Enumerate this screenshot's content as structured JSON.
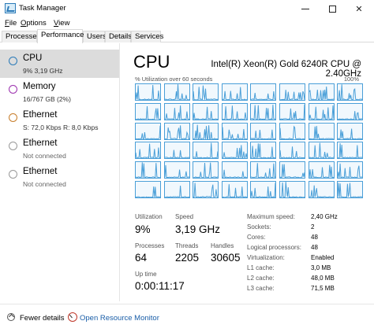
{
  "window": {
    "title": "Task Manager"
  },
  "menu": [
    {
      "underline": "F",
      "rest": "ile"
    },
    {
      "underline": "O",
      "rest": "ptions"
    },
    {
      "underline": "V",
      "rest": "iew"
    }
  ],
  "tabs": [
    "Processes",
    "Performance",
    "Users",
    "Details",
    "Services"
  ],
  "active_tab": "Performance",
  "resources": [
    {
      "name": "CPU",
      "sub": "9% 3,19 GHz",
      "color": "#2a7ab8",
      "selected": true
    },
    {
      "name": "Memory",
      "sub": "16/767 GB (2%)",
      "color": "#9b2fae",
      "selected": false
    },
    {
      "name": "Ethernet",
      "sub": "S: 72,0 Kbps  R: 8,0 Kbps",
      "color": "#c77d2a",
      "selected": false
    },
    {
      "name": "Ethernet",
      "sub": "Not connected",
      "color": "#999999",
      "selected": false
    },
    {
      "name": "Ethernet",
      "sub": "Not connected",
      "color": "#999999",
      "selected": false
    }
  ],
  "main": {
    "title": "CPU",
    "model": "Intel(R) Xeon(R) Gold 6240R CPU @ 2.40GHz",
    "util_label": "% Utilization over 60 seconds",
    "util_max": "100%",
    "graph_color": "#4a9fd8",
    "stats": {
      "utilization_label": "Utilization",
      "utilization": "9%",
      "speed_label": "Speed",
      "speed": "3,19 GHz",
      "processes_label": "Processes",
      "processes": "64",
      "threads_label": "Threads",
      "threads": "2205",
      "handles_label": "Handles",
      "handles": "30605",
      "uptime_label": "Up time",
      "uptime": "0:00:11:17"
    },
    "specs": [
      {
        "label": "Maximum speed:",
        "value": "2,40 GHz"
      },
      {
        "label": "Sockets:",
        "value": "2"
      },
      {
        "label": "Cores:",
        "value": "48"
      },
      {
        "label": "Logical processors:",
        "value": "48"
      },
      {
        "label": "Virtualization:",
        "value": "Enabled"
      },
      {
        "label": "L1 cache:",
        "value": "3,0 MB"
      },
      {
        "label": "L2 cache:",
        "value": "48,0 MB"
      },
      {
        "label": "L3 cache:",
        "value": "71,5 MB"
      }
    ]
  },
  "footer": {
    "fewer_details": "Fewer details",
    "open_resource_monitor": "Open Resource Monitor"
  }
}
